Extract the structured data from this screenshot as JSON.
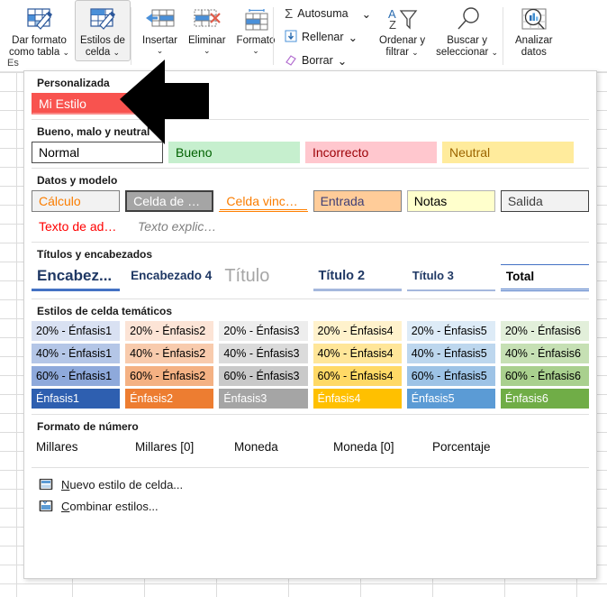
{
  "ribbon": {
    "buttons": [
      {
        "label_line1": "Dar formato",
        "label_line2": "como tabla",
        "icon": "format-as-table-icon",
        "chevron": "⌄"
      },
      {
        "label_line1": "Estilos de",
        "label_line2": "celda",
        "icon": "cell-styles-icon",
        "chevron": "⌄"
      },
      {
        "label_line1": "Insertar",
        "label_line2": "",
        "icon": "insert-cells-icon",
        "chevron": "⌄"
      },
      {
        "label_line1": "Eliminar",
        "label_line2": "",
        "icon": "delete-cells-icon",
        "chevron": "⌄"
      },
      {
        "label_line1": "Formato",
        "label_line2": "",
        "icon": "format-cells-icon",
        "chevron": "⌄"
      },
      {
        "label_line1": "Ordenar y",
        "label_line2": "filtrar",
        "icon": "sort-filter-icon",
        "chevron": "⌄"
      },
      {
        "label_line1": "Buscar y",
        "label_line2": "seleccionar",
        "icon": "find-select-icon",
        "chevron": "⌄"
      },
      {
        "label_line1": "Analizar",
        "label_line2": "datos",
        "icon": "analyze-data-icon",
        "chevron": ""
      }
    ],
    "small_buttons": [
      {
        "label": "Autosuma",
        "icon": "sigma-icon",
        "chevron": "⌄"
      },
      {
        "label": "Rellenar",
        "icon": "fill-down-icon",
        "chevron": "⌄"
      },
      {
        "label": "Borrar",
        "icon": "eraser-icon",
        "chevron": "⌄"
      }
    ],
    "group_label_partial": "Es"
  },
  "gallery": {
    "sections": [
      {
        "name": "personalizada",
        "title": "Personalizada",
        "items": [
          {
            "label": "Mi Estilo",
            "style": "custom-mi-estilo"
          }
        ]
      },
      {
        "name": "bueno-malo-neutral",
        "title": "Bueno, malo y neutral",
        "items": [
          {
            "label": "Normal",
            "style": "s-normal"
          },
          {
            "label": "Bueno",
            "style": "s-bueno"
          },
          {
            "label": "Incorrecto",
            "style": "s-incor"
          },
          {
            "label": "Neutral",
            "style": "s-neutral"
          }
        ]
      },
      {
        "name": "datos-y-modelo",
        "title": "Datos y modelo",
        "items": [
          {
            "label": "Cálculo",
            "style": "s-calculo"
          },
          {
            "label": "Celda de co...",
            "style": "s-comprob"
          },
          {
            "label": "Celda vincul...",
            "style": "s-vincul"
          },
          {
            "label": "Entrada",
            "style": "s-entrada"
          },
          {
            "label": "Notas",
            "style": "s-notas"
          },
          {
            "label": "Salida",
            "style": "s-salida"
          }
        ],
        "items_row2": [
          {
            "label": "Texto de adv...",
            "style": "s-adv"
          },
          {
            "label": "Texto explica...",
            "style": "s-expl"
          }
        ]
      },
      {
        "name": "titulos-y-encabezados",
        "title": "Títulos y encabezados",
        "items": [
          {
            "label": "Encabez...",
            "style": "t-enc1"
          },
          {
            "label": "Encabezado 4",
            "style": "t-enc4"
          },
          {
            "label": "Título",
            "style": "t-titulo"
          },
          {
            "label": "Título 2",
            "style": "t-t2"
          },
          {
            "label": "Título 3",
            "style": "t-t3"
          },
          {
            "label": "Total",
            "style": "t-total"
          }
        ]
      },
      {
        "name": "estilos-de-celda-tematicos",
        "title": "Estilos de celda temáticos",
        "rows": [
          [
            {
              "label": "20% - Énfasis1",
              "bg": "#d9e1f2",
              "fg": "#000000"
            },
            {
              "label": "20% - Énfasis2",
              "bg": "#fce4d6",
              "fg": "#000000"
            },
            {
              "label": "20% - Énfasis3",
              "bg": "#ededed",
              "fg": "#000000"
            },
            {
              "label": "20% - Énfasis4",
              "bg": "#fff2cc",
              "fg": "#000000"
            },
            {
              "label": "20% - Énfasis5",
              "bg": "#ddebf7",
              "fg": "#000000"
            },
            {
              "label": "20% - Énfasis6",
              "bg": "#e2efda",
              "fg": "#000000"
            }
          ],
          [
            {
              "label": "40% - Énfasis1",
              "bg": "#b4c6e7",
              "fg": "#000000"
            },
            {
              "label": "40% - Énfasis2",
              "bg": "#f8cbad",
              "fg": "#000000"
            },
            {
              "label": "40% - Énfasis3",
              "bg": "#dbdbdb",
              "fg": "#000000"
            },
            {
              "label": "40% - Énfasis4",
              "bg": "#ffe699",
              "fg": "#000000"
            },
            {
              "label": "40% - Énfasis5",
              "bg": "#bdd7ee",
              "fg": "#000000"
            },
            {
              "label": "40% - Énfasis6",
              "bg": "#c6e0b4",
              "fg": "#000000"
            }
          ],
          [
            {
              "label": "60% - Énfasis1",
              "bg": "#8ea9db",
              "fg": "#000000"
            },
            {
              "label": "60% - Énfasis2",
              "bg": "#f4b183",
              "fg": "#000000"
            },
            {
              "label": "60% - Énfasis3",
              "bg": "#c9c9c9",
              "fg": "#000000"
            },
            {
              "label": "60% - Énfasis4",
              "bg": "#ffd966",
              "fg": "#000000"
            },
            {
              "label": "60% - Énfasis5",
              "bg": "#9dc3e6",
              "fg": "#000000"
            },
            {
              "label": "60% - Énfasis6",
              "bg": "#a9d08e",
              "fg": "#000000"
            }
          ],
          [
            {
              "label": "Énfasis1",
              "bg": "#2e5fb0",
              "fg": "#ffffff"
            },
            {
              "label": "Énfasis2",
              "bg": "#ed7d31",
              "fg": "#ffffff"
            },
            {
              "label": "Énfasis3",
              "bg": "#a5a5a5",
              "fg": "#ffffff"
            },
            {
              "label": "Énfasis4",
              "bg": "#ffc000",
              "fg": "#ffffff"
            },
            {
              "label": "Énfasis5",
              "bg": "#5b9bd5",
              "fg": "#ffffff"
            },
            {
              "label": "Énfasis6",
              "bg": "#70ad47",
              "fg": "#ffffff"
            }
          ]
        ]
      },
      {
        "name": "formato-de-numero",
        "title": "Formato de número",
        "items": [
          {
            "label": "Millares"
          },
          {
            "label": "Millares [0]"
          },
          {
            "label": "Moneda"
          },
          {
            "label": "Moneda [0]"
          },
          {
            "label": "Porcentaje"
          }
        ]
      }
    ],
    "commands": [
      {
        "label": "Nuevo estilo de celda...",
        "accel": "N",
        "rest": "uevo estilo de celda...",
        "icon": "new-cell-style-icon"
      },
      {
        "label": "Combinar estilos...",
        "accel": "C",
        "rest": "ombinar estilos...",
        "icon": "merge-styles-icon"
      }
    ]
  },
  "overlay": {
    "arrow": {
      "name": "pointer-arrow-left",
      "color": "#000000"
    }
  },
  "colors": {
    "custom_style_bg": "#f8534f",
    "custom_style_fg": "#ffffff",
    "panel_border": "#d0d0d0",
    "accent_blue": "#4472c4"
  }
}
